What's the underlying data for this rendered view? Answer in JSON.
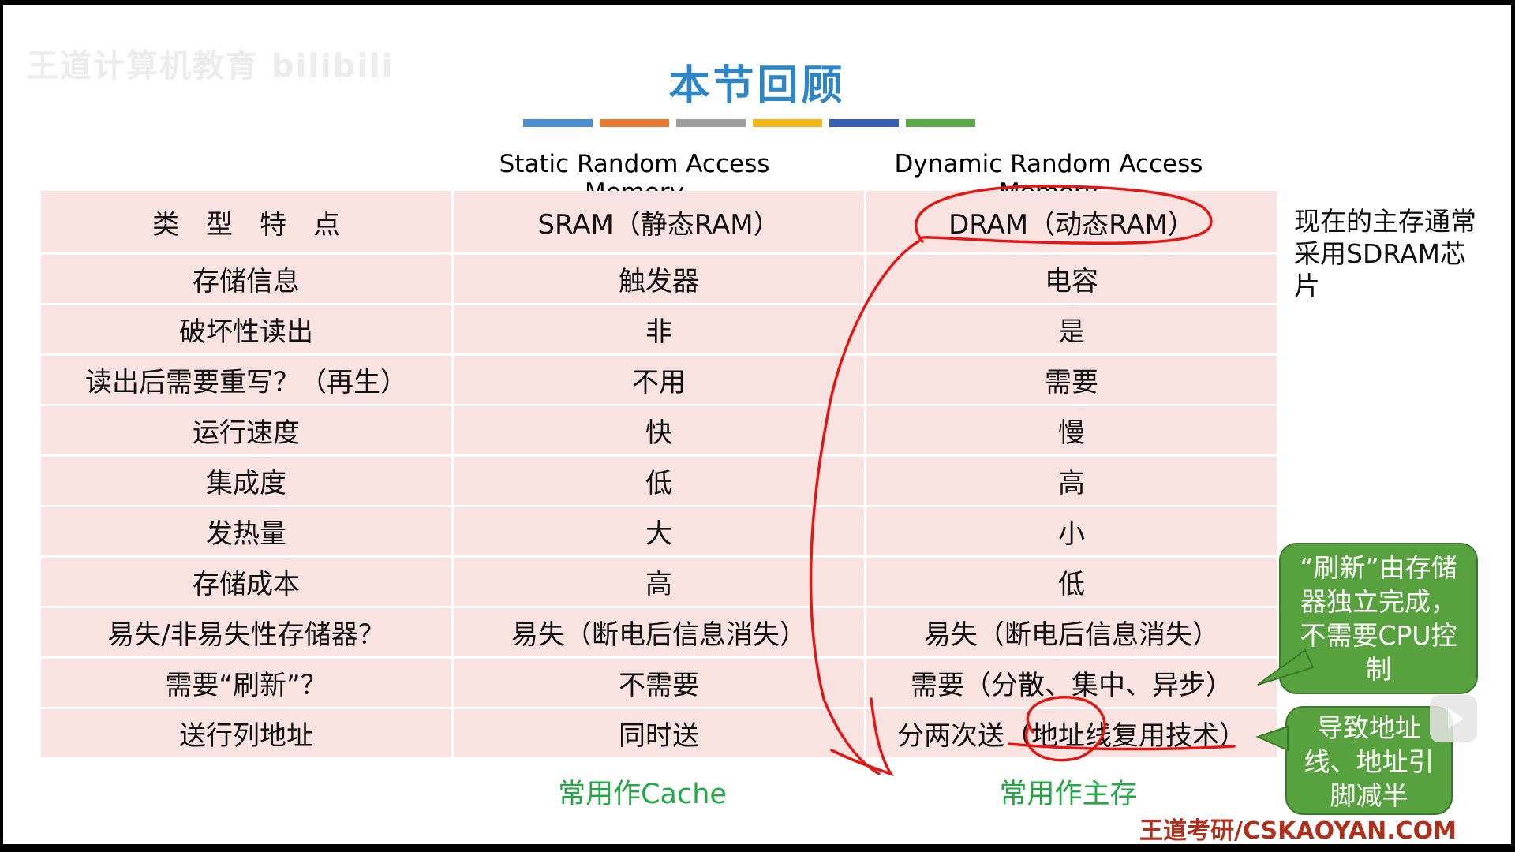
{
  "watermark": "王道计算机教育 bilibili",
  "title": "本节回顾",
  "title_bar_colors": [
    "#4a90d0",
    "#e57a30",
    "#9e9e9e",
    "#f2b619",
    "#3660b8",
    "#5aa846"
  ],
  "column_headers": {
    "sram": "Static Random Access Memory",
    "dram": "Dynamic Random Access Memory"
  },
  "table": {
    "rows": [
      [
        "类　型　特　点",
        "SRAM（静态RAM）",
        "DRAM（动态RAM）"
      ],
      [
        "存储信息",
        "触发器",
        "电容"
      ],
      [
        "破坏性读出",
        "非",
        "是"
      ],
      [
        "读出后需要重写？（再生）",
        "不用",
        "需要"
      ],
      [
        "运行速度",
        "快",
        "慢"
      ],
      [
        "集成度",
        "低",
        "高"
      ],
      [
        "发热量",
        "大",
        "小"
      ],
      [
        "存储成本",
        "高",
        "低"
      ],
      [
        "易失/非易失性存储器？",
        "易失（断电后信息消失）",
        "易失（断电后信息消失）"
      ],
      [
        "需要“刷新”？",
        "不需要",
        "需要（分散、集中、异步）"
      ],
      [
        "送行列地址",
        "同时送",
        "分两次送（地址线复用技术）"
      ]
    ]
  },
  "usage": {
    "sram": "常用作Cache",
    "dram": "常用作主存"
  },
  "side_note": "现在的主存通常采用SDRAM芯片",
  "callouts": {
    "refresh": "“刷新”由存储器独立完成，不需要CPU控制",
    "address": "导致地址线、地址引脚减半"
  },
  "brand": "王道考研/CSKAOYAN.COM",
  "icons": [
    "play-icon"
  ],
  "annotation_color": "#e01818",
  "callout_color": "#57a23e"
}
